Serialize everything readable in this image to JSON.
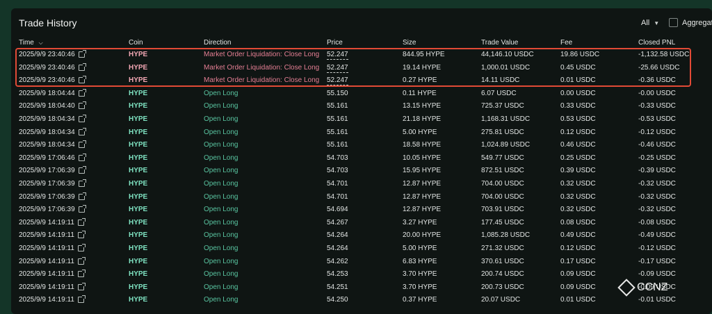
{
  "panel": {
    "title": "Trade History",
    "filter": {
      "selected": "All"
    },
    "aggregate_label": "Aggregate"
  },
  "columns": {
    "time": "Time",
    "coin": "Coin",
    "direction": "Direction",
    "price": "Price",
    "size": "Size",
    "trade_value": "Trade Value",
    "fee": "Fee",
    "closed_pnl": "Closed PNL"
  },
  "rows": [
    {
      "time": "2025/9/9 23:40:46",
      "coin": "HYPE",
      "direction": "Market Order Liquidation: Close Long",
      "price": "52.247",
      "size": "844.95 HYPE",
      "trade_value": "44,146.10 USDC",
      "fee": "19.86 USDC",
      "pnl": "-1,132.58 USDC",
      "type": "liq"
    },
    {
      "time": "2025/9/9 23:40:46",
      "coin": "HYPE",
      "direction": "Market Order Liquidation: Close Long",
      "price": "52.247",
      "size": "19.14 HYPE",
      "trade_value": "1,000.01 USDC",
      "fee": "0.45 USDC",
      "pnl": "-25.66 USDC",
      "type": "liq"
    },
    {
      "time": "2025/9/9 23:40:46",
      "coin": "HYPE",
      "direction": "Market Order Liquidation: Close Long",
      "price": "52.247",
      "size": "0.27 HYPE",
      "trade_value": "14.11 USDC",
      "fee": "0.01 USDC",
      "pnl": "-0.36 USDC",
      "type": "liq"
    },
    {
      "time": "2025/9/9 18:04:44",
      "coin": "HYPE",
      "direction": "Open Long",
      "price": "55.150",
      "size": "0.11 HYPE",
      "trade_value": "6.07 USDC",
      "fee": "0.00 USDC",
      "pnl": "-0.00 USDC",
      "type": "long"
    },
    {
      "time": "2025/9/9 18:04:40",
      "coin": "HYPE",
      "direction": "Open Long",
      "price": "55.161",
      "size": "13.15 HYPE",
      "trade_value": "725.37 USDC",
      "fee": "0.33 USDC",
      "pnl": "-0.33 USDC",
      "type": "long"
    },
    {
      "time": "2025/9/9 18:04:34",
      "coin": "HYPE",
      "direction": "Open Long",
      "price": "55.161",
      "size": "21.18 HYPE",
      "trade_value": "1,168.31 USDC",
      "fee": "0.53 USDC",
      "pnl": "-0.53 USDC",
      "type": "long"
    },
    {
      "time": "2025/9/9 18:04:34",
      "coin": "HYPE",
      "direction": "Open Long",
      "price": "55.161",
      "size": "5.00 HYPE",
      "trade_value": "275.81 USDC",
      "fee": "0.12 USDC",
      "pnl": "-0.12 USDC",
      "type": "long"
    },
    {
      "time": "2025/9/9 18:04:34",
      "coin": "HYPE",
      "direction": "Open Long",
      "price": "55.161",
      "size": "18.58 HYPE",
      "trade_value": "1,024.89 USDC",
      "fee": "0.46 USDC",
      "pnl": "-0.46 USDC",
      "type": "long"
    },
    {
      "time": "2025/9/9 17:06:46",
      "coin": "HYPE",
      "direction": "Open Long",
      "price": "54.703",
      "size": "10.05 HYPE",
      "trade_value": "549.77 USDC",
      "fee": "0.25 USDC",
      "pnl": "-0.25 USDC",
      "type": "long"
    },
    {
      "time": "2025/9/9 17:06:39",
      "coin": "HYPE",
      "direction": "Open Long",
      "price": "54.703",
      "size": "15.95 HYPE",
      "trade_value": "872.51 USDC",
      "fee": "0.39 USDC",
      "pnl": "-0.39 USDC",
      "type": "long"
    },
    {
      "time": "2025/9/9 17:06:39",
      "coin": "HYPE",
      "direction": "Open Long",
      "price": "54.701",
      "size": "12.87 HYPE",
      "trade_value": "704.00 USDC",
      "fee": "0.32 USDC",
      "pnl": "-0.32 USDC",
      "type": "long"
    },
    {
      "time": "2025/9/9 17:06:39",
      "coin": "HYPE",
      "direction": "Open Long",
      "price": "54.701",
      "size": "12.87 HYPE",
      "trade_value": "704.00 USDC",
      "fee": "0.32 USDC",
      "pnl": "-0.32 USDC",
      "type": "long"
    },
    {
      "time": "2025/9/9 17:06:39",
      "coin": "HYPE",
      "direction": "Open Long",
      "price": "54.694",
      "size": "12.87 HYPE",
      "trade_value": "703.91 USDC",
      "fee": "0.32 USDC",
      "pnl": "-0.32 USDC",
      "type": "long"
    },
    {
      "time": "2025/9/9 14:19:11",
      "coin": "HYPE",
      "direction": "Open Long",
      "price": "54.267",
      "size": "3.27 HYPE",
      "trade_value": "177.45 USDC",
      "fee": "0.08 USDC",
      "pnl": "-0.08 USDC",
      "type": "long"
    },
    {
      "time": "2025/9/9 14:19:11",
      "coin": "HYPE",
      "direction": "Open Long",
      "price": "54.264",
      "size": "20.00 HYPE",
      "trade_value": "1,085.28 USDC",
      "fee": "0.49 USDC",
      "pnl": "-0.49 USDC",
      "type": "long"
    },
    {
      "time": "2025/9/9 14:19:11",
      "coin": "HYPE",
      "direction": "Open Long",
      "price": "54.264",
      "size": "5.00 HYPE",
      "trade_value": "271.32 USDC",
      "fee": "0.12 USDC",
      "pnl": "-0.12 USDC",
      "type": "long"
    },
    {
      "time": "2025/9/9 14:19:11",
      "coin": "HYPE",
      "direction": "Open Long",
      "price": "54.262",
      "size": "6.83 HYPE",
      "trade_value": "370.61 USDC",
      "fee": "0.17 USDC",
      "pnl": "-0.17 USDC",
      "type": "long"
    },
    {
      "time": "2025/9/9 14:19:11",
      "coin": "HYPE",
      "direction": "Open Long",
      "price": "54.253",
      "size": "3.70 HYPE",
      "trade_value": "200.74 USDC",
      "fee": "0.09 USDC",
      "pnl": "-0.09 USDC",
      "type": "long"
    },
    {
      "time": "2025/9/9 14:19:11",
      "coin": "HYPE",
      "direction": "Open Long",
      "price": "54.251",
      "size": "3.70 HYPE",
      "trade_value": "200.73 USDC",
      "fee": "0.09 USDC",
      "pnl": "-0.09 USDC",
      "type": "long"
    },
    {
      "time": "2025/9/9 14:19:11",
      "coin": "HYPE",
      "direction": "Open Long",
      "price": "54.250",
      "size": "0.37 HYPE",
      "trade_value": "20.07 USDC",
      "fee": "0.01 USDC",
      "pnl": "-0.01 USDC",
      "type": "long"
    }
  ],
  "watermark": "CCNZ",
  "colors": {
    "background": "#0f1513",
    "outer": "#143528",
    "long_green": "#59c4a0",
    "liquidation_pink": "#e57f94",
    "highlight_red": "#e24a36"
  }
}
